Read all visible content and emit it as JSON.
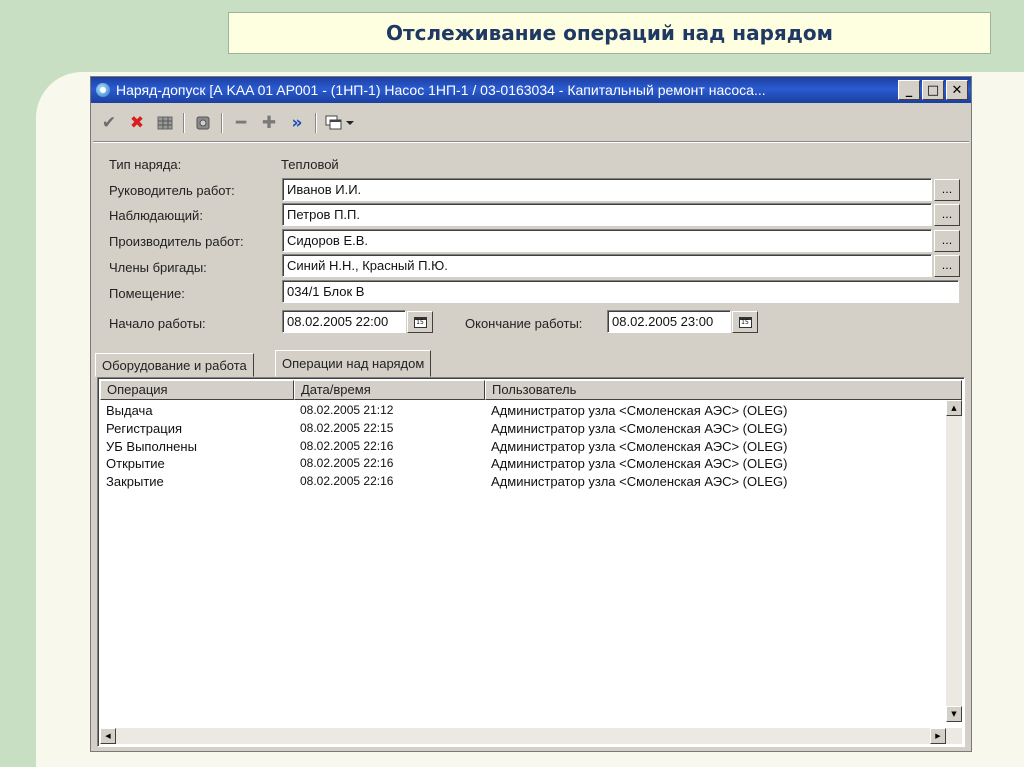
{
  "slide": {
    "title": "Отслеживание операций над нарядом"
  },
  "window": {
    "title": "Наряд-допуск [А    KAA 01 AP001 - (1НП-1) Насос 1НП-1  /  03-0163034 - Капитальный ремонт насоса...",
    "minimize": "_",
    "maximize": "□",
    "close": "✕"
  },
  "toolbar": {
    "icons": [
      "check-icon",
      "cross-icon",
      "grid-icon",
      "gear-icon",
      "minus-icon",
      "plus-icon",
      "double-chevron-icon",
      "window-stack-icon"
    ],
    "colors": {
      "check": "#6d6d6d",
      "cross": "#d81e1e",
      "minus": "#7a7a7a",
      "plus": "#7a7a7a",
      "chevron": "#1a4fbf"
    }
  },
  "form": {
    "type_label": "Тип наряда:",
    "type_value": "Тепловой",
    "manager_label": "Руководитель работ:",
    "manager_value": "Иванов И.И.",
    "observer_label": "Наблюдающий:",
    "observer_value": "Петров П.П.",
    "producer_label": "Производитель работ:",
    "producer_value": "Сидоров Е.В.",
    "crew_label": "Члены бригады:",
    "crew_value": "Синий Н.Н., Красный П.Ю.",
    "room_label": "Помещение:",
    "room_value": "034/1 Блок В",
    "start_label": "Начало работы:",
    "start_value": "08.02.2005 22:00",
    "end_label": "Окончание работы:",
    "end_value": "08.02.2005 23:00",
    "ellipsis": "...",
    "calendar_glyph": "15"
  },
  "tabs": [
    {
      "label": "Оборудование и работа",
      "active": false
    },
    {
      "label": "Операции над нарядом",
      "active": true
    }
  ],
  "grid": {
    "columns": [
      "Операция",
      "Дата/время",
      "Пользователь"
    ],
    "rows": [
      [
        "Выдача",
        "08.02.2005 21:12",
        "Администратор узла <Смоленская АЭС> (OLEG)"
      ],
      [
        "Регистрация",
        "08.02.2005 22:15",
        "Администратор узла <Смоленская АЭС> (OLEG)"
      ],
      [
        "УБ Выполнены",
        "08.02.2005 22:16",
        "Администратор узла <Смоленская АЭС> (OLEG)"
      ],
      [
        "Открытие",
        "08.02.2005 22:16",
        "Администратор узла <Смоленская АЭС> (OLEG)"
      ],
      [
        "Закрытие",
        "08.02.2005 22:16",
        "Администратор узла <Смоленская АЭС> (OLEG)"
      ]
    ]
  },
  "scroll": {
    "up": "▲",
    "down": "▼",
    "left": "◀",
    "right": "▶"
  }
}
